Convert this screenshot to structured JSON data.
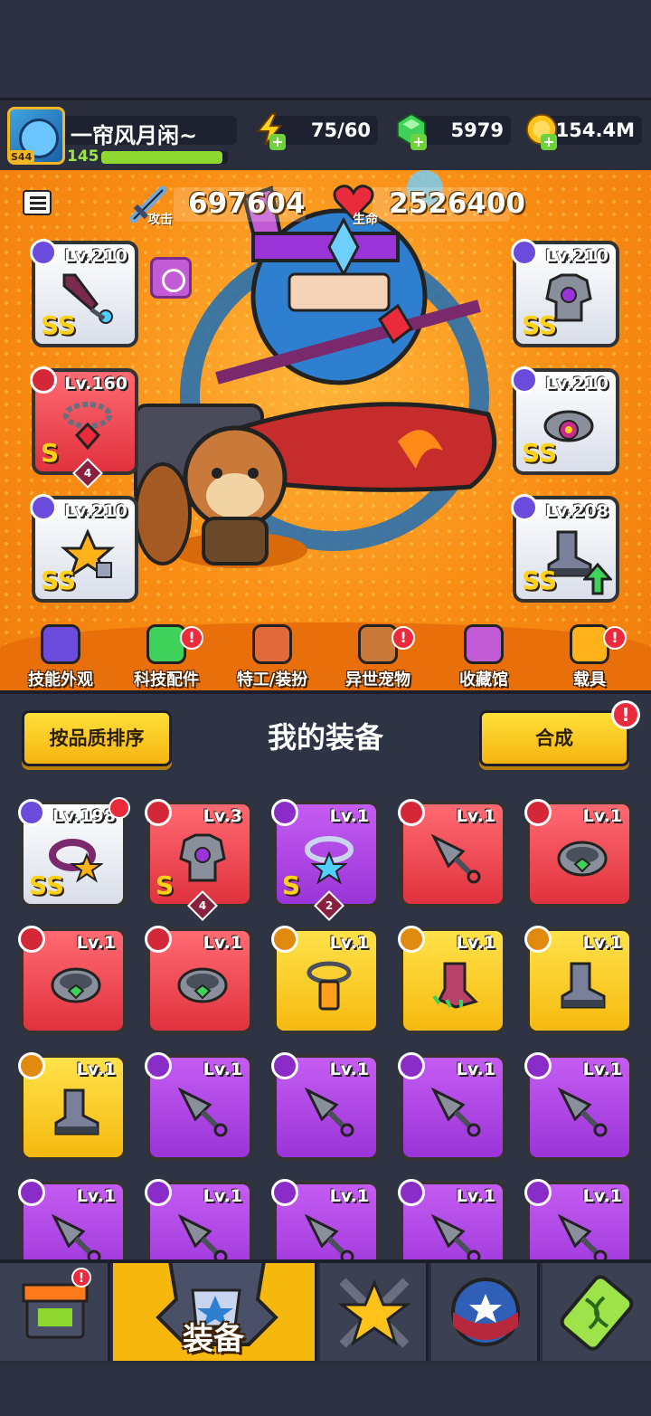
{
  "player": {
    "name": "一帘风月闲~",
    "level": "145",
    "avatar_tag": "S44",
    "xp_progress": 0.96
  },
  "resources": {
    "energy": "75/60",
    "gems": "5979",
    "coins": "154.4M"
  },
  "stats": {
    "attack_label": "攻击",
    "attack_value": "697604",
    "hp_label": "生命",
    "hp_value": "2526400"
  },
  "equipped": {
    "left": [
      {
        "level": "Lv.210",
        "grade": "SS",
        "color": "white",
        "item": "sword-icon"
      },
      {
        "level": "Lv.160",
        "grade": "S",
        "color": "red",
        "item": "chain-necklace-icon",
        "stars": "4"
      },
      {
        "level": "Lv.210",
        "grade": "SS",
        "color": "white",
        "item": "star-gauntlet-icon"
      }
    ],
    "right": [
      {
        "level": "Lv.210",
        "grade": "SS",
        "color": "white",
        "item": "armor-icon"
      },
      {
        "level": "Lv.210",
        "grade": "SS",
        "color": "white",
        "item": "belt-icon"
      },
      {
        "level": "Lv.208",
        "grade": "SS",
        "color": "white",
        "item": "boots-icon",
        "upgrade": true
      }
    ]
  },
  "features": [
    {
      "label": "技能外观",
      "icon": "skill-skin-icon",
      "badge": false
    },
    {
      "label": "科技配件",
      "icon": "tech-parts-icon",
      "badge": true
    },
    {
      "label": "特工/装扮",
      "icon": "agent-costume-icon",
      "badge": false
    },
    {
      "label": "异世宠物",
      "icon": "pet-icon",
      "badge": true
    },
    {
      "label": "收藏馆",
      "icon": "collection-icon",
      "badge": false
    },
    {
      "label": "载具",
      "icon": "vehicle-icon",
      "badge": true
    }
  ],
  "equipment_panel": {
    "sort_button": "按品质排序",
    "title": "我的装备",
    "merge_button": "合成",
    "alert": "!"
  },
  "inventory": [
    {
      "level": "Lv.198",
      "color": "white",
      "grade": "SS",
      "item": "star-belt-icon",
      "badge": true
    },
    {
      "level": "Lv.3",
      "color": "red",
      "grade": "S",
      "item": "armor-icon",
      "stars": "4"
    },
    {
      "level": "Lv.1",
      "color": "purple",
      "grade": "S",
      "item": "star-necklace-icon",
      "stars": "2"
    },
    {
      "level": "Lv.1",
      "color": "red",
      "grade": "",
      "item": "kunai-icon"
    },
    {
      "level": "Lv.1",
      "color": "red",
      "grade": "",
      "item": "ring-belt-icon"
    },
    {
      "level": "Lv.1",
      "color": "red",
      "grade": "",
      "item": "ring-belt-icon"
    },
    {
      "level": "Lv.1",
      "color": "red",
      "grade": "",
      "item": "ring-belt-icon"
    },
    {
      "level": "Lv.1",
      "color": "yellow",
      "grade": "",
      "item": "battery-necklace-icon"
    },
    {
      "level": "Lv.1",
      "color": "yellow",
      "grade": "",
      "item": "claw-boots-icon"
    },
    {
      "level": "Lv.1",
      "color": "yellow",
      "grade": "",
      "item": "boots-icon"
    },
    {
      "level": "Lv.1",
      "color": "yellow",
      "grade": "",
      "item": "boots-icon"
    },
    {
      "level": "Lv.1",
      "color": "purple",
      "grade": "",
      "item": "kunai-icon"
    },
    {
      "level": "Lv.1",
      "color": "purple",
      "grade": "",
      "item": "kunai-icon"
    },
    {
      "level": "Lv.1",
      "color": "purple",
      "grade": "",
      "item": "kunai-icon"
    },
    {
      "level": "Lv.1",
      "color": "purple",
      "grade": "",
      "item": "kunai-icon"
    },
    {
      "level": "Lv.1",
      "color": "purple",
      "grade": "",
      "item": "kunai-icon"
    },
    {
      "level": "Lv.1",
      "color": "purple",
      "grade": "",
      "item": "kunai-icon"
    },
    {
      "level": "Lv.1",
      "color": "purple",
      "grade": "",
      "item": "kunai-icon"
    },
    {
      "level": "Lv.1",
      "color": "purple",
      "grade": "",
      "item": "kunai-icon"
    },
    {
      "level": "Lv.1",
      "color": "purple",
      "grade": "",
      "item": "kunai-icon"
    }
  ],
  "nav": {
    "active_label": "装备",
    "items": [
      "shop-icon",
      "equipment-icon",
      "skills-star-icon",
      "stars-orb-icon",
      "dna-icon"
    ]
  },
  "colors": {
    "slot_white": "#ffffff",
    "slot_red": "#e0323e",
    "slot_purple": "#9b34d8",
    "slot_yellow": "#f6b90f",
    "hero_bg": "#f98d14",
    "accent_yellow": "#f7b80e"
  }
}
